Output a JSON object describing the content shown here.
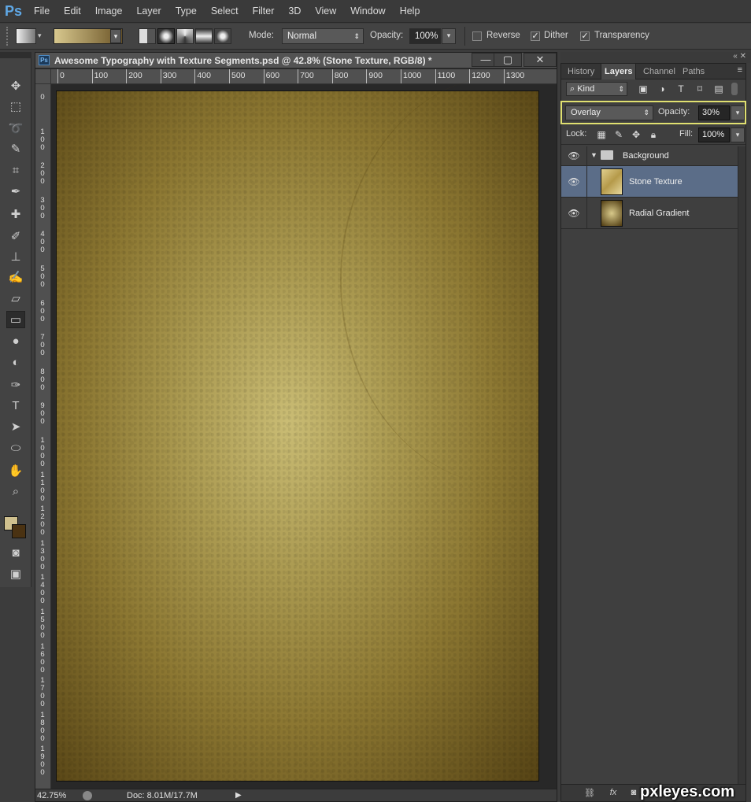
{
  "app": {
    "logo": "Ps"
  },
  "menu": [
    "File",
    "Edit",
    "Image",
    "Layer",
    "Type",
    "Select",
    "Filter",
    "3D",
    "View",
    "Window",
    "Help"
  ],
  "options": {
    "mode_label": "Mode:",
    "mode_value": "Normal",
    "opacity_label": "Opacity:",
    "opacity_value": "100%",
    "reverse_label": "Reverse",
    "reverse_checked": false,
    "dither_label": "Dither",
    "dither_checked": true,
    "transparency_label": "Transparency",
    "transparency_checked": true
  },
  "document": {
    "title": "Awesome Typography with Texture Segments.psd @ 42.8% (Stone Texture, RGB/8) *",
    "ruler_top": [
      "0",
      "100",
      "200",
      "300",
      "400",
      "500",
      "600",
      "700",
      "800",
      "900",
      "1000",
      "1100",
      "1200",
      "1300"
    ],
    "ruler_left": [
      "0",
      "1\n0\n0",
      "2\n0\n0",
      "3\n0\n0",
      "4\n0\n0",
      "5\n0\n0",
      "6\n0\n0",
      "7\n0\n0",
      "8\n0\n0",
      "9\n0\n0",
      "1\n0\n0\n0",
      "1\n1\n0\n0",
      "1\n2\n0\n0",
      "1\n3\n0\n0",
      "1\n4\n0\n0",
      "1\n5\n0\n0",
      "1\n6\n0\n0",
      "1\n7\n0\n0",
      "1\n8\n0\n0",
      "1\n9\n0\n0"
    ]
  },
  "status": {
    "zoom": "42.75%",
    "doc_size": "Doc: 8.01M/17.7M"
  },
  "panels": {
    "tabs": [
      "History",
      "Layers",
      "Channel",
      "Paths"
    ],
    "active_tab": "Layers",
    "filter_kind": "Kind",
    "blend_mode": "Overlay",
    "opacity_label": "Opacity:",
    "opacity_value": "30%",
    "lock_label": "Lock:",
    "fill_label": "Fill:",
    "fill_value": "100%",
    "layers": [
      {
        "name": "Background",
        "type": "group",
        "visible": true
      },
      {
        "name": "Stone Texture",
        "type": "layer",
        "visible": true,
        "selected": true
      },
      {
        "name": "Radial Gradient",
        "type": "layer",
        "visible": true
      }
    ]
  },
  "watermark": "pxleyes.com"
}
